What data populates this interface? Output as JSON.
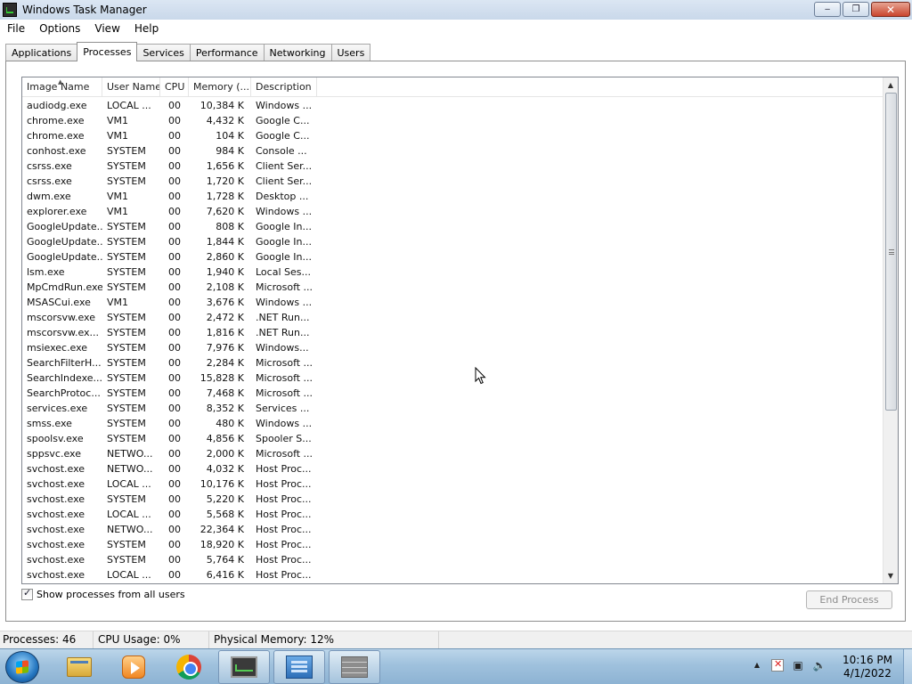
{
  "window": {
    "title": "Windows Task Manager",
    "controls": {
      "minimize": "‒",
      "restore": "❐",
      "close": "✕"
    }
  },
  "menu": [
    "File",
    "Options",
    "View",
    "Help"
  ],
  "tabs": [
    "Applications",
    "Processes",
    "Services",
    "Performance",
    "Networking",
    "Users"
  ],
  "active_tab": "Processes",
  "columns": [
    "Image Name",
    "User Name",
    "CPU",
    "Memory (...",
    "Description"
  ],
  "sort_indicator": "▲",
  "processes": [
    {
      "name": "audiodg.exe",
      "user": "LOCAL ...",
      "cpu": "00",
      "memory": "10,384 K",
      "description": "Windows ..."
    },
    {
      "name": "chrome.exe",
      "user": "VM1",
      "cpu": "00",
      "memory": "4,432 K",
      "description": "Google C..."
    },
    {
      "name": "chrome.exe",
      "user": "VM1",
      "cpu": "00",
      "memory": "104 K",
      "description": "Google C..."
    },
    {
      "name": "conhost.exe",
      "user": "SYSTEM",
      "cpu": "00",
      "memory": "984 K",
      "description": "Console ..."
    },
    {
      "name": "csrss.exe",
      "user": "SYSTEM",
      "cpu": "00",
      "memory": "1,656 K",
      "description": "Client Ser..."
    },
    {
      "name": "csrss.exe",
      "user": "SYSTEM",
      "cpu": "00",
      "memory": "1,720 K",
      "description": "Client Ser..."
    },
    {
      "name": "dwm.exe",
      "user": "VM1",
      "cpu": "00",
      "memory": "1,728 K",
      "description": "Desktop ..."
    },
    {
      "name": "explorer.exe",
      "user": "VM1",
      "cpu": "00",
      "memory": "7,620 K",
      "description": "Windows ..."
    },
    {
      "name": "GoogleUpdate...",
      "user": "SYSTEM",
      "cpu": "00",
      "memory": "808 K",
      "description": "Google In..."
    },
    {
      "name": "GoogleUpdate...",
      "user": "SYSTEM",
      "cpu": "00",
      "memory": "1,844 K",
      "description": "Google In..."
    },
    {
      "name": "GoogleUpdate...",
      "user": "SYSTEM",
      "cpu": "00",
      "memory": "2,860 K",
      "description": "Google In..."
    },
    {
      "name": "lsm.exe",
      "user": "SYSTEM",
      "cpu": "00",
      "memory": "1,940 K",
      "description": "Local Ses..."
    },
    {
      "name": "MpCmdRun.exe",
      "user": "SYSTEM",
      "cpu": "00",
      "memory": "2,108 K",
      "description": "Microsoft ..."
    },
    {
      "name": "MSASCui.exe",
      "user": "VM1",
      "cpu": "00",
      "memory": "3,676 K",
      "description": "Windows ..."
    },
    {
      "name": "mscorsvw.exe",
      "user": "SYSTEM",
      "cpu": "00",
      "memory": "2,472 K",
      "description": ".NET Run..."
    },
    {
      "name": "mscorsvw.ex...",
      "user": "SYSTEM",
      "cpu": "00",
      "memory": "1,816 K",
      "description": ".NET Run..."
    },
    {
      "name": "msiexec.exe",
      "user": "SYSTEM",
      "cpu": "00",
      "memory": "7,976 K",
      "description": "Windows..."
    },
    {
      "name": "SearchFilterH...",
      "user": "SYSTEM",
      "cpu": "00",
      "memory": "2,284 K",
      "description": "Microsoft ..."
    },
    {
      "name": "SearchIndexe...",
      "user": "SYSTEM",
      "cpu": "00",
      "memory": "15,828 K",
      "description": "Microsoft ..."
    },
    {
      "name": "SearchProtoc...",
      "user": "SYSTEM",
      "cpu": "00",
      "memory": "7,468 K",
      "description": "Microsoft ..."
    },
    {
      "name": "services.exe",
      "user": "SYSTEM",
      "cpu": "00",
      "memory": "8,352 K",
      "description": "Services ..."
    },
    {
      "name": "smss.exe",
      "user": "SYSTEM",
      "cpu": "00",
      "memory": "480 K",
      "description": "Windows ..."
    },
    {
      "name": "spoolsv.exe",
      "user": "SYSTEM",
      "cpu": "00",
      "memory": "4,856 K",
      "description": "Spooler S..."
    },
    {
      "name": "sppsvc.exe",
      "user": "NETWO...",
      "cpu": "00",
      "memory": "2,000 K",
      "description": "Microsoft ..."
    },
    {
      "name": "svchost.exe",
      "user": "NETWO...",
      "cpu": "00",
      "memory": "4,032 K",
      "description": "Host Proc..."
    },
    {
      "name": "svchost.exe",
      "user": "LOCAL ...",
      "cpu": "00",
      "memory": "10,176 K",
      "description": "Host Proc..."
    },
    {
      "name": "svchost.exe",
      "user": "SYSTEM",
      "cpu": "00",
      "memory": "5,220 K",
      "description": "Host Proc..."
    },
    {
      "name": "svchost.exe",
      "user": "LOCAL ...",
      "cpu": "00",
      "memory": "5,568 K",
      "description": "Host Proc..."
    },
    {
      "name": "svchost.exe",
      "user": "NETWO...",
      "cpu": "00",
      "memory": "22,364 K",
      "description": "Host Proc..."
    },
    {
      "name": "svchost.exe",
      "user": "SYSTEM",
      "cpu": "00",
      "memory": "18,920 K",
      "description": "Host Proc..."
    },
    {
      "name": "svchost.exe",
      "user": "SYSTEM",
      "cpu": "00",
      "memory": "5,764 K",
      "description": "Host Proc..."
    },
    {
      "name": "svchost.exe",
      "user": "LOCAL ...",
      "cpu": "00",
      "memory": "6,416 K",
      "description": "Host Proc..."
    }
  ],
  "show_all_users": {
    "label": "Show processes from all users",
    "checked": true
  },
  "end_process_label": "End Process",
  "status": {
    "processes": "Processes: 46",
    "cpu": "CPU Usage: 0%",
    "memory": "Physical Memory: 12%"
  },
  "taskbar": {
    "apps": [
      "windows-explorer",
      "media-player",
      "chrome",
      "task-manager",
      "network-settings",
      "firewall"
    ],
    "tray_up_arrow": "▲",
    "tray_speaker": "🔈",
    "time": "10:16 PM",
    "date": "4/1/2022"
  },
  "colors": {
    "taskbar": "#9fc1dd",
    "titlebar": "#c9d8ea",
    "close_button": "#c9452d"
  }
}
